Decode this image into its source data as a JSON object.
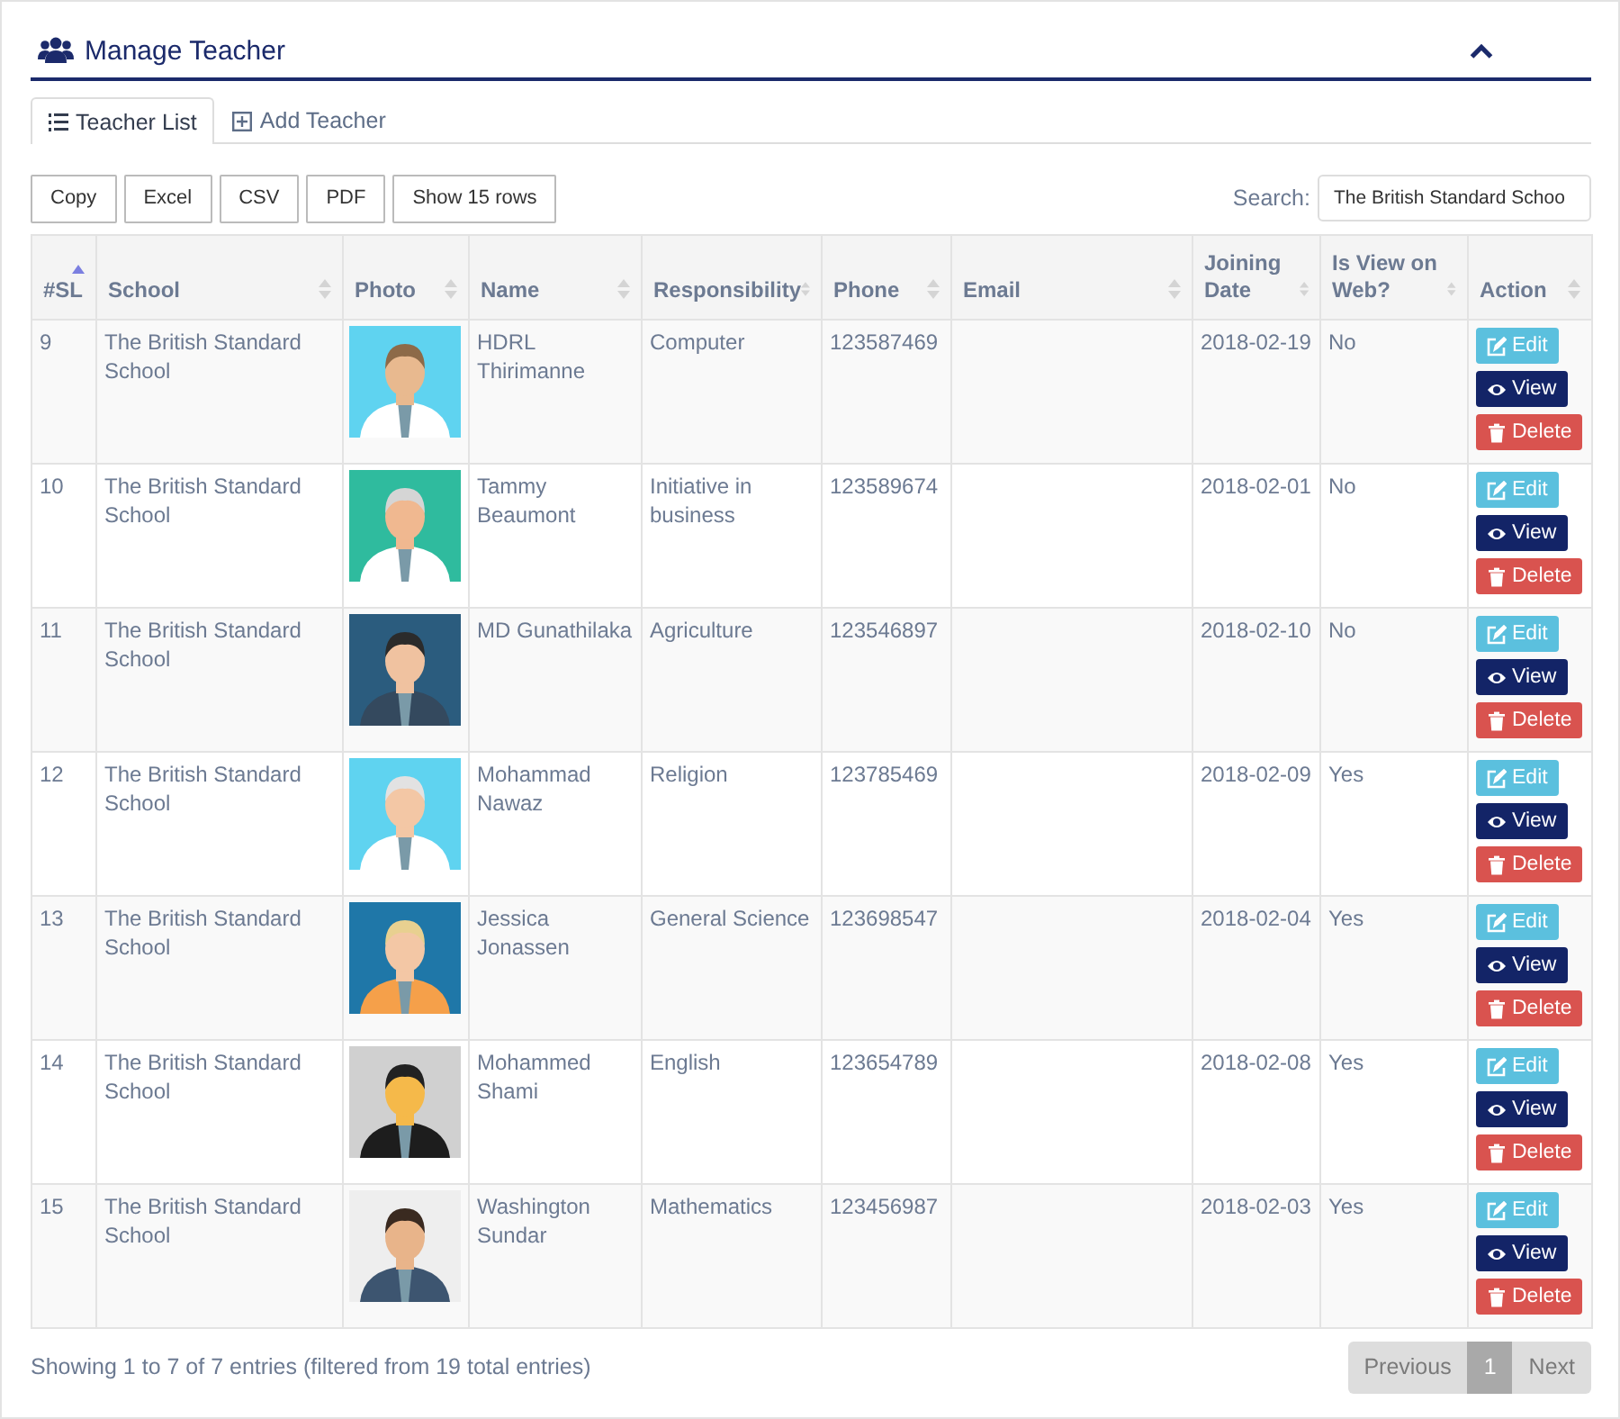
{
  "panel": {
    "title": "Manage Teacher"
  },
  "tabs": [
    {
      "label": "Teacher List",
      "selected": true,
      "kind": "list"
    },
    {
      "label": "Add Teacher",
      "selected": false,
      "kind": "add"
    }
  ],
  "export_buttons": [
    "Copy",
    "Excel",
    "CSV",
    "PDF",
    "Show 15 rows"
  ],
  "search": {
    "label": "Search:",
    "value": "The British Standard Schoo"
  },
  "table": {
    "columns": [
      {
        "label": "#SL",
        "sorted_ascending": true
      },
      {
        "label": "School",
        "sorted_ascending": false
      },
      {
        "label": "Photo",
        "sorted_ascending": false
      },
      {
        "label": "Name",
        "sorted_ascending": false
      },
      {
        "label": "Responsibility",
        "sorted_ascending": false
      },
      {
        "label": "Phone",
        "sorted_ascending": false
      },
      {
        "label": "Email",
        "sorted_ascending": false
      },
      {
        "label": "Joining Date",
        "sorted_ascending": false
      },
      {
        "label": "Is View on Web?",
        "sorted_ascending": false
      },
      {
        "label": "Action",
        "sorted_ascending": false
      }
    ],
    "rows": [
      {
        "sl": "9",
        "school": "The British Standard School",
        "name": "HDRL Thirimanne",
        "responsibility": "Computer",
        "phone": "123587469",
        "joining_date": "2018-02-19",
        "view_on_web": "No",
        "actions": [
          {
            "label": "Edit",
            "kind": "edit"
          },
          {
            "label": "View",
            "kind": "view"
          },
          {
            "label": "Delete",
            "kind": "delete"
          }
        ]
      },
      {
        "sl": "10",
        "school": "The British Standard School",
        "name": "Tammy Beaumont",
        "responsibility": "Initiative in business",
        "phone": "123589674",
        "joining_date": "2018-02-01",
        "view_on_web": "No",
        "actions": [
          {
            "label": "Edit",
            "kind": "edit"
          },
          {
            "label": "View",
            "kind": "view"
          },
          {
            "label": "Delete",
            "kind": "delete"
          }
        ]
      },
      {
        "sl": "11",
        "school": "The British Standard School",
        "name": "MD Gunathilaka",
        "responsibility": "Agriculture",
        "phone": "123546897",
        "joining_date": "2018-02-10",
        "view_on_web": "No",
        "actions": [
          {
            "label": "Edit",
            "kind": "edit"
          },
          {
            "label": "View",
            "kind": "view"
          },
          {
            "label": "Delete",
            "kind": "delete"
          }
        ]
      },
      {
        "sl": "12",
        "school": "The British Standard School",
        "name": "Mohammad Nawaz",
        "responsibility": "Religion",
        "phone": "123785469",
        "joining_date": "2018-02-09",
        "view_on_web": "Yes",
        "actions": [
          {
            "label": "Edit",
            "kind": "edit"
          },
          {
            "label": "View",
            "kind": "view"
          },
          {
            "label": "Delete",
            "kind": "delete"
          }
        ]
      },
      {
        "sl": "13",
        "school": "The British Standard School",
        "name": "Jessica Jonassen",
        "responsibility": "General Science",
        "phone": "123698547",
        "joining_date": "2018-02-04",
        "view_on_web": "Yes",
        "actions": [
          {
            "label": "Edit",
            "kind": "edit"
          },
          {
            "label": "View",
            "kind": "view"
          },
          {
            "label": "Delete",
            "kind": "delete"
          }
        ]
      },
      {
        "sl": "14",
        "school": "The British Standard School",
        "name": "Mohammed Shami",
        "responsibility": "English",
        "phone": "123654789",
        "joining_date": "2018-02-08",
        "view_on_web": "Yes",
        "actions": [
          {
            "label": "Edit",
            "kind": "edit"
          },
          {
            "label": "View",
            "kind": "view"
          },
          {
            "label": "Delete",
            "kind": "delete"
          }
        ]
      },
      {
        "sl": "15",
        "school": "The British Standard School",
        "name": "Washington Sundar",
        "responsibility": "Mathematics",
        "phone": "123456987",
        "joining_date": "2018-02-03",
        "view_on_web": "Yes",
        "actions": [
          {
            "label": "Edit",
            "kind": "edit"
          },
          {
            "label": "View",
            "kind": "view"
          },
          {
            "label": "Delete",
            "kind": "delete"
          }
        ]
      }
    ]
  },
  "footer": {
    "info": "Showing 1 to 7 of 7 entries (filtered from 19 total entries)"
  },
  "pagination": [
    {
      "label": "Previous",
      "disabled": true
    },
    {
      "label": "1",
      "selected": true
    },
    {
      "label": "Next",
      "disabled": true
    }
  ]
}
